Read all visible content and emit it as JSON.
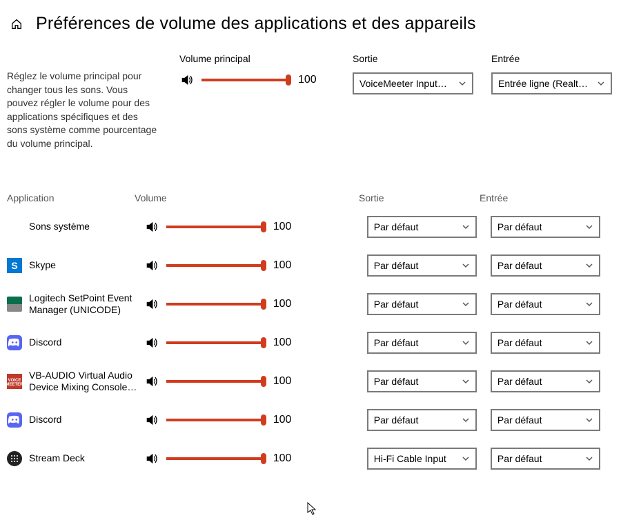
{
  "title": "Préférences de volume des applications et des appareils",
  "description": "Réglez le volume principal pour changer tous les sons. Vous pouvez régler le volume pour des applications spécifiques et des sons système comme pourcentage du volume principal.",
  "master": {
    "label": "Volume principal",
    "value": 100,
    "output_label": "Sortie",
    "output_value": "VoiceMeeter Input…",
    "input_label": "Entrée",
    "input_value": "Entrée ligne (Realt…"
  },
  "headers": {
    "app": "Application",
    "vol": "Volume",
    "out": "Sortie",
    "in": "Entrée"
  },
  "default_label": "Par défaut",
  "apps": [
    {
      "name": "Sons système",
      "icon": "none",
      "volume": 100,
      "output": "Par défaut",
      "input": "Par défaut"
    },
    {
      "name": "Skype",
      "icon": "skype",
      "volume": 100,
      "output": "Par défaut",
      "input": "Par défaut"
    },
    {
      "name": "Logitech SetPoint Event Manager (UNICODE)",
      "icon": "logi",
      "volume": 100,
      "output": "Par défaut",
      "input": "Par défaut"
    },
    {
      "name": "Discord",
      "icon": "discord",
      "volume": 100,
      "output": "Par défaut",
      "input": "Par défaut"
    },
    {
      "name": "VB-AUDIO Virtual Audio Device Mixing Console…",
      "icon": "vb",
      "volume": 100,
      "output": "Par défaut",
      "input": "Par défaut"
    },
    {
      "name": "Discord",
      "icon": "discord",
      "volume": 100,
      "output": "Par défaut",
      "input": "Par défaut"
    },
    {
      "name": "Stream Deck",
      "icon": "streamdeck",
      "volume": 100,
      "output": "Hi-Fi Cable Input",
      "input": "Par défaut"
    }
  ]
}
